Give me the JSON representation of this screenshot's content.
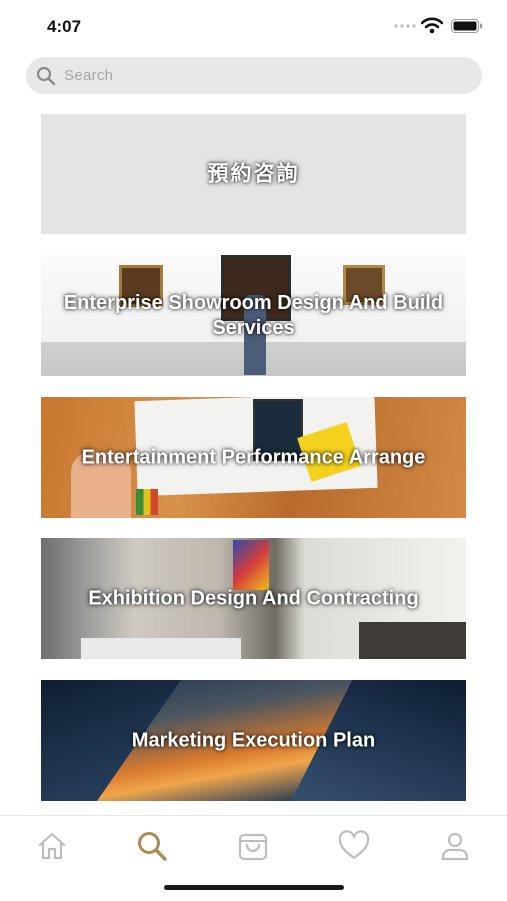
{
  "status_bar": {
    "time": "4:07"
  },
  "search": {
    "placeholder": "Search"
  },
  "cards": [
    {
      "label": "預約咨詢"
    },
    {
      "label": "Enterprise Showroom Design And Build Services"
    },
    {
      "label": "Entertainment  Performance Arrange"
    },
    {
      "label": "Exhibition Design And  Contracting"
    },
    {
      "label": "Marketing Execution Plan"
    }
  ],
  "tab_bar": {
    "active_tab": "search",
    "tabs": [
      "home-icon",
      "search-icon",
      "shopping-bag-icon",
      "heart-icon",
      "profile-icon"
    ],
    "active_color": "#b08a54",
    "inactive_color": "#bdbdbd"
  }
}
